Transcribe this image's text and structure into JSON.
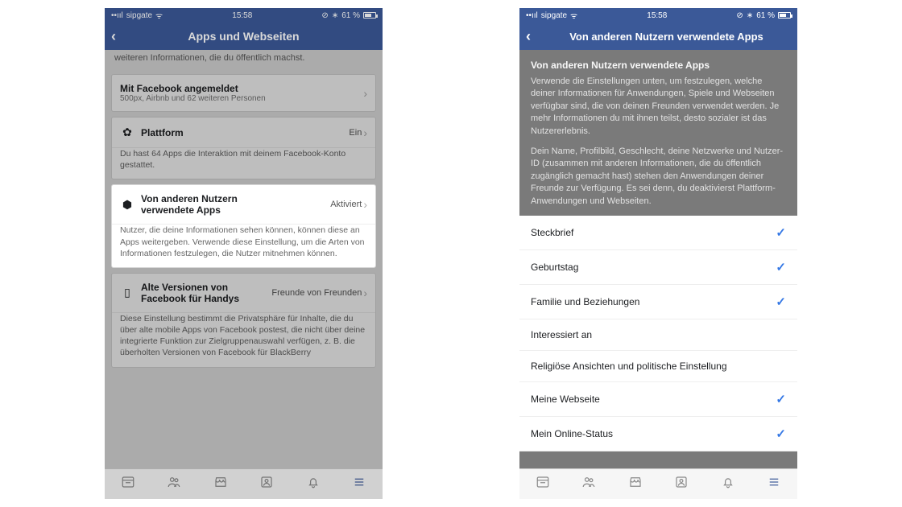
{
  "status": {
    "carrier": "sipgate",
    "wifi": "⟂",
    "time": "15:58",
    "battery": "61 %",
    "bt": "✱"
  },
  "left": {
    "nav_title": "Apps und Webseiten",
    "snippet": "weiteren Informationen, die du öffentlich machst.",
    "row_login_title": "Mit Facebook angemeldet",
    "row_login_sub": "500px, Airbnb und 62 weiteren Personen",
    "row_platform_title": "Plattform",
    "row_platform_value": "Ein",
    "row_platform_desc": "Du hast 64 Apps die Interaktion mit deinem Facebook-Konto gestattet.",
    "row_others_title": "Von anderen Nutzern verwendete Apps",
    "row_others_value": "Aktiviert",
    "row_others_desc": "Nutzer, die deine Informationen sehen können, können diese an Apps weitergeben. Verwende diese Einstellung, um die Arten von Informationen festzulegen, die Nutzer mitnehmen können.",
    "row_old_title": "Alte Versionen von Facebook für Handys",
    "row_old_value": "Freunde von Freunden",
    "row_old_desc": "Diese Einstellung bestimmt die Privatsphäre für Inhalte, die du über alte mobile Apps von Facebook postest, die nicht über deine integrierte Funktion zur Zielgruppenauswahl verfügen, z. B. die überholten Versionen von Facebook für BlackBerry"
  },
  "right": {
    "nav_title": "Von anderen Nutzern verwendete Apps",
    "heading": "Von anderen Nutzern verwendete Apps",
    "para1": "Verwende die Einstellungen unten, um festzulegen, welche deiner Informationen für Anwendungen, Spiele und Webseiten verfügbar sind, die von deinen Freunden verwendet werden. Je mehr Informationen du mit ihnen teilst, desto sozialer ist das Nutzererlebnis.",
    "para2": "Dein Name, Profilbild, Geschlecht, deine Netzwerke und Nutzer-ID (zusammen mit anderen Informationen, die du öffentlich zugänglich gemacht hast) stehen den Anwendungen deiner Freunde zur Verfügung. Es sei denn, du deaktivierst Plattform-Anwendungen und Webseiten.",
    "items": [
      {
        "label": "Steckbrief",
        "checked": true
      },
      {
        "label": "Geburtstag",
        "checked": true
      },
      {
        "label": "Familie und Beziehungen",
        "checked": true
      },
      {
        "label": "Interessiert an",
        "checked": false
      },
      {
        "label": "Religiöse Ansichten und politische Einstellung",
        "checked": false
      },
      {
        "label": "Meine Webseite",
        "checked": true
      },
      {
        "label": "Mein Online-Status",
        "checked": true
      }
    ]
  }
}
